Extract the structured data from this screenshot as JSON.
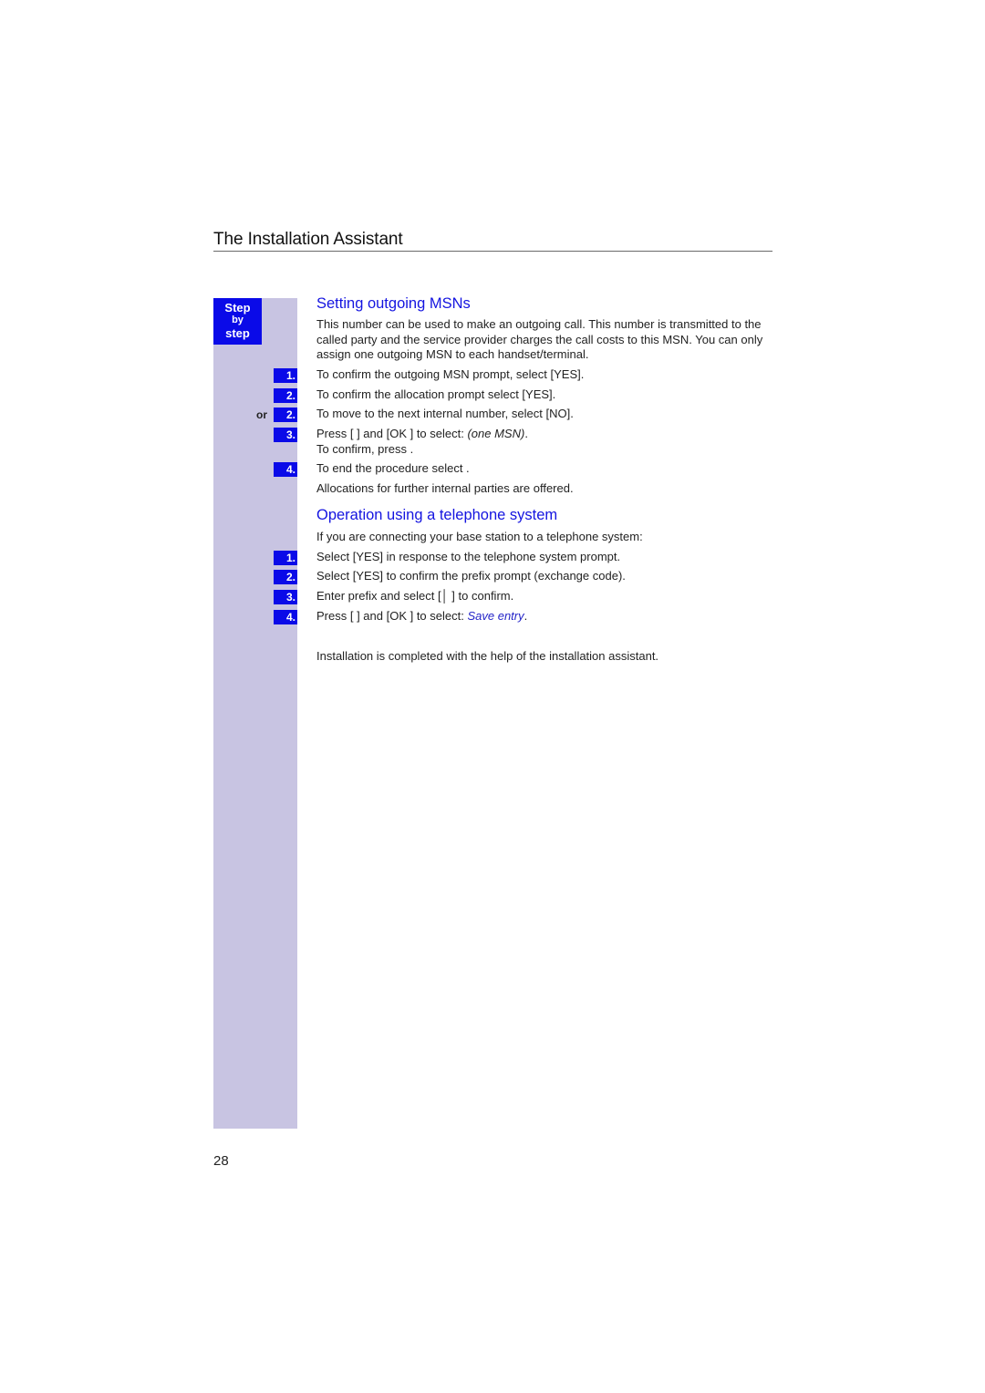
{
  "header": {
    "title": "The Installation Assistant"
  },
  "sidebar": {
    "badge": [
      "Step",
      "by",
      "step"
    ]
  },
  "section1": {
    "heading": "Setting outgoing MSNs",
    "intro": "This number can be used to make an outgoing call. This number is transmitted to the called party and the service provider charges the call costs to this MSN. You can only assign one outgoing MSN to each handset/terminal.",
    "or_label": "or",
    "steps": [
      {
        "num": "1.",
        "text": "To confirm the outgoing MSN prompt, select [YES]."
      },
      {
        "num": "2.",
        "text": "To confirm the allocation prompt select [YES]."
      },
      {
        "num": "2.",
        "text": "To move to the next internal number, select [NO]."
      },
      {
        "num": "3.",
        "text_a": "Press [   ] and [OK ] to select: ",
        "text_em": "(one MSN)",
        "text_b": ".",
        "line2": "To confirm, press   ."
      },
      {
        "num": "4.",
        "text": "To end the procedure select        ."
      }
    ],
    "note": "Allocations for further internal parties are offered."
  },
  "section2": {
    "heading": "Operation using a telephone system",
    "intro": "If you are connecting your base station to a telephone system:",
    "steps": [
      {
        "num": "1.",
        "text": "Select [YES] in response to the telephone system prompt."
      },
      {
        "num": "2.",
        "text": "Select [YES] to confirm the prefix prompt (exchange code)."
      },
      {
        "num": "3.",
        "text": "Enter prefix and select [│   ] to confirm."
      },
      {
        "num": "4.",
        "text_a": "Press [   ] and [OK ] to select: ",
        "text_em": "Save entry",
        "text_b": "."
      }
    ],
    "closing": "Installation is completed with the help of the installation assistant."
  },
  "footer": {
    "page_number": "28"
  }
}
